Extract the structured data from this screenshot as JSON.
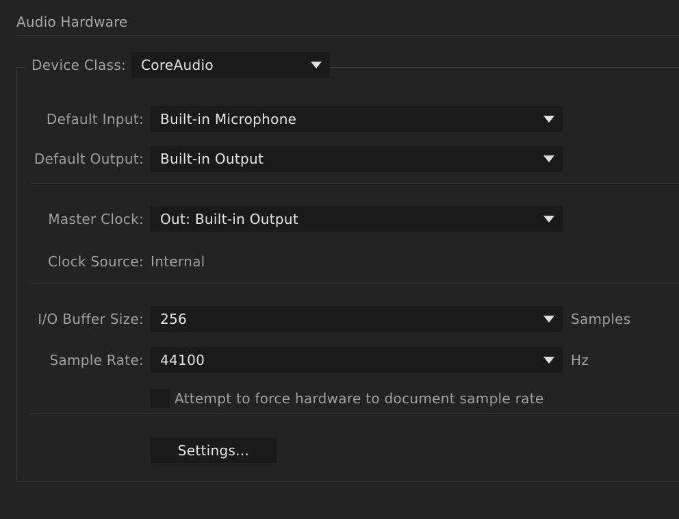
{
  "section": {
    "title": "Audio Hardware"
  },
  "device_class": {
    "label": "Device Class:",
    "value": "CoreAudio"
  },
  "default_input": {
    "label": "Default Input:",
    "value": "Built-in Microphone"
  },
  "default_output": {
    "label": "Default Output:",
    "value": "Built-in Output"
  },
  "master_clock": {
    "label": "Master Clock:",
    "value": "Out: Built-in Output"
  },
  "clock_source": {
    "label": "Clock Source:",
    "value": "Internal"
  },
  "buffer_size": {
    "label": "I/O Buffer Size:",
    "value": "256",
    "unit": "Samples"
  },
  "sample_rate": {
    "label": "Sample Rate:",
    "value": "44100",
    "unit": "Hz"
  },
  "force_rate": {
    "label": "Attempt to force hardware to document sample rate",
    "checked": false
  },
  "settings_button": {
    "label": "Settings..."
  },
  "icons": {
    "dropdown": "chevron-down-icon"
  },
  "colors": {
    "background": "#232323",
    "control_background": "#1a1a1a",
    "label_text": "#a0a0a0",
    "value_text": "#e6e6e6",
    "divider": "#3a3a3a"
  }
}
